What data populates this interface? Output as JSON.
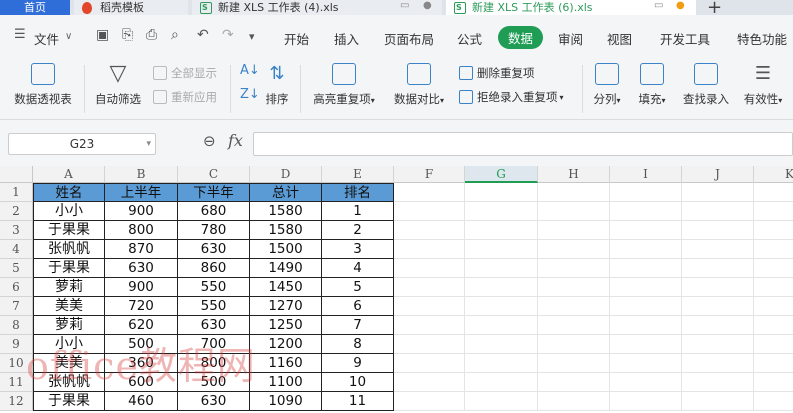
{
  "tabs": {
    "home": "首页",
    "template": "稻壳模板",
    "file1": "新建 XLS 工作表 (4).xls",
    "file2": "新建 XLS 工作表 (6).xls",
    "new_tab": "+"
  },
  "menubar": {
    "file_menu": "文件",
    "items": [
      "开始",
      "插入",
      "页面布局",
      "公式",
      "数据",
      "审阅",
      "视图",
      "开发工具",
      "特色功能"
    ],
    "active": "数据"
  },
  "ribbon": {
    "pivot": "数据透视表",
    "auto_filter": "自动筛选",
    "show_all": "全部显示",
    "reapply": "重新应用",
    "sort": "排序",
    "highlight_dup": "高亮重复项",
    "data_compare": "数据对比",
    "remove_dup": "删除重复项",
    "reject_dup": "拒绝录入重复项",
    "split": "分列",
    "fill": "填充",
    "lookup": "查找录入",
    "validity": "有效性"
  },
  "formula_bar": {
    "name_box": "G23",
    "fx_label": "fx",
    "formula": ""
  },
  "sheet": {
    "columns": [
      "A",
      "B",
      "C",
      "D",
      "E",
      "F",
      "G",
      "H",
      "I",
      "J",
      "K"
    ],
    "selected_column": "G",
    "row_numbers": [
      "1",
      "2",
      "3",
      "4",
      "5",
      "6",
      "7",
      "8",
      "9",
      "10",
      "11",
      "12"
    ],
    "header": [
      "姓名",
      "上半年",
      "下半年",
      "总计",
      "排名"
    ],
    "rows": [
      [
        "小小",
        "900",
        "680",
        "1580",
        "1"
      ],
      [
        "于果果",
        "800",
        "780",
        "1580",
        "2"
      ],
      [
        "张帆帆",
        "870",
        "630",
        "1500",
        "3"
      ],
      [
        "于果果",
        "630",
        "860",
        "1490",
        "4"
      ],
      [
        "萝莉",
        "900",
        "550",
        "1450",
        "5"
      ],
      [
        "美美",
        "720",
        "550",
        "1270",
        "6"
      ],
      [
        "萝莉",
        "620",
        "630",
        "1250",
        "7"
      ],
      [
        "小小",
        "500",
        "700",
        "1200",
        "8"
      ],
      [
        "美美",
        "360",
        "800",
        "1160",
        "9"
      ],
      [
        "张帆帆",
        "600",
        "500",
        "1100",
        "10"
      ],
      [
        "于果果",
        "460",
        "630",
        "1090",
        "11"
      ]
    ]
  },
  "watermark": "office教程网",
  "colors": {
    "accent": "#1f9d55",
    "header_fill": "#5b9bd5",
    "home_tab": "#2f6dd8"
  }
}
